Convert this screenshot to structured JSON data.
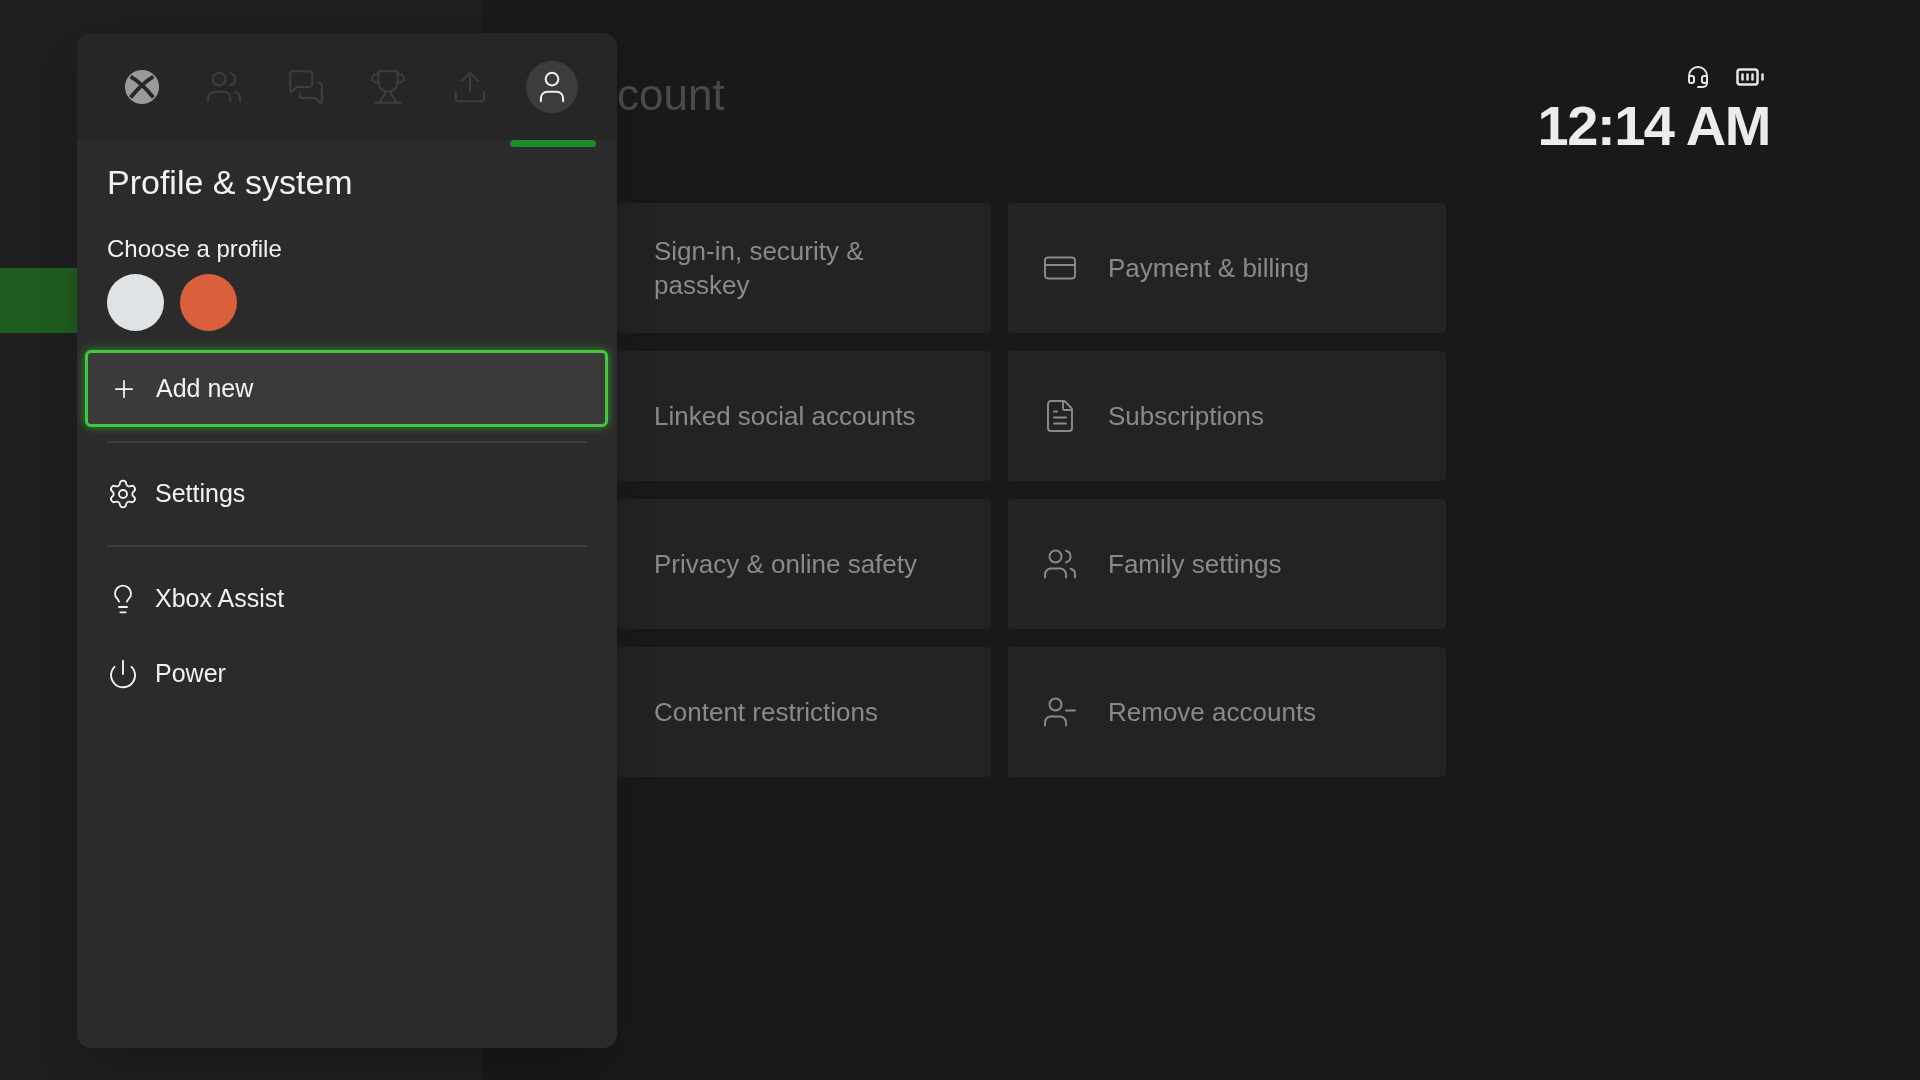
{
  "background": {
    "title": "count",
    "clock": "12:14 AM",
    "tiles": [
      {
        "label": "Sign-in, security & passkey"
      },
      {
        "label": "Payment & billing"
      },
      {
        "label": "Linked social accounts"
      },
      {
        "label": "Subscriptions"
      },
      {
        "label": "Privacy & online safety"
      },
      {
        "label": "Family settings"
      },
      {
        "label": "Content restrictions"
      },
      {
        "label": "Remove accounts"
      }
    ]
  },
  "guide": {
    "tabs": [
      {
        "selected": false
      },
      {
        "selected": false
      },
      {
        "selected": false
      },
      {
        "selected": false
      },
      {
        "selected": false
      },
      {
        "selected": true
      }
    ],
    "title": "Profile & system",
    "profiles_label": "Choose a profile",
    "profiles": [
      {
        "color": "#dfe3e6"
      },
      {
        "color": "#d9603a"
      }
    ],
    "add_new": {
      "label": "Add new",
      "focused": true
    },
    "menu": [
      {
        "label": "Settings"
      },
      {
        "label": "Xbox Assist"
      },
      {
        "label": "Power"
      }
    ]
  }
}
